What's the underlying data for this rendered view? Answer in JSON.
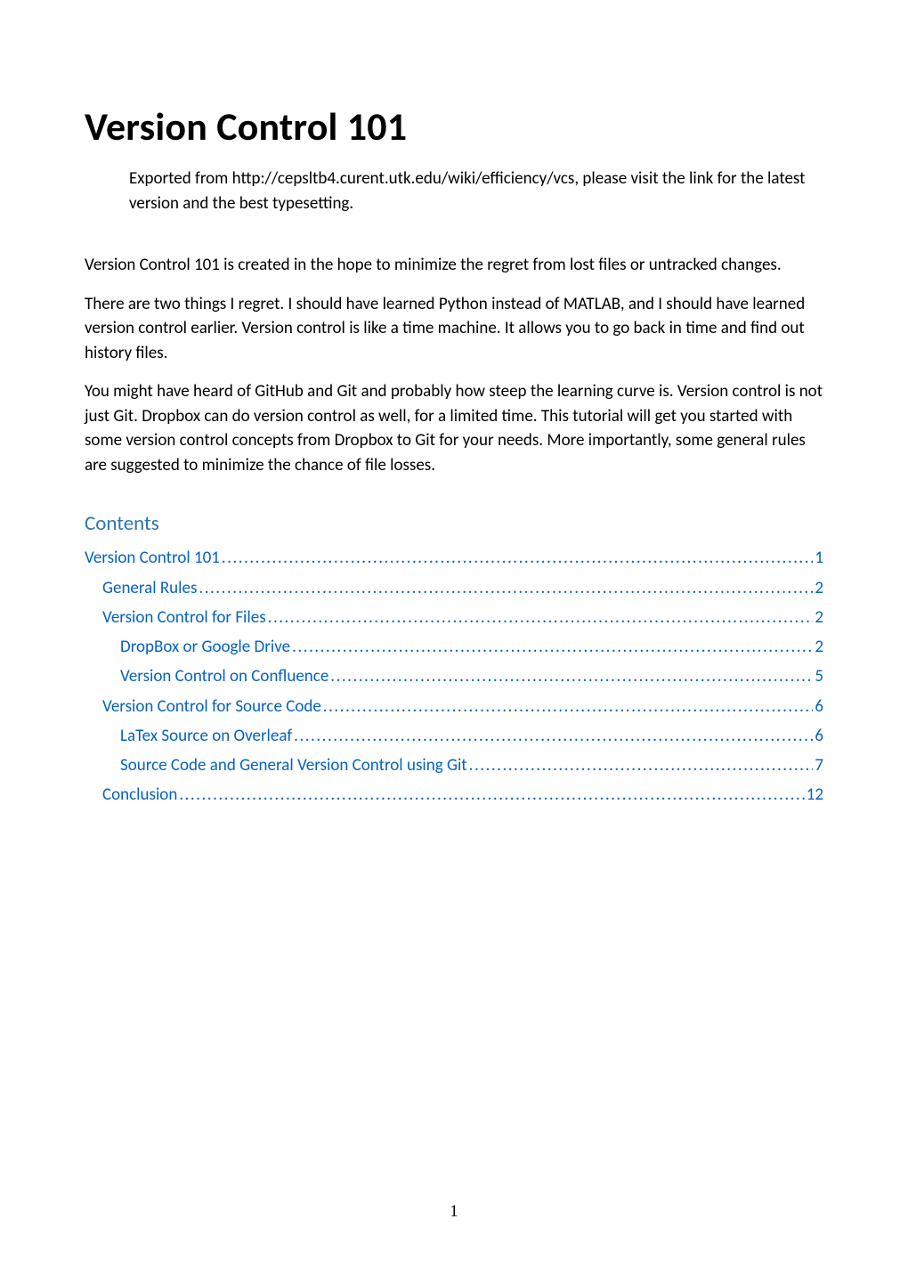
{
  "title": "Version Control 101",
  "export_note": "Exported from http://cepsltb4.curent.utk.edu/wiki/efficiency/vcs, please visit the link for the latest version and the best typesetting.",
  "paragraphs": [
    "Version Control 101 is created in the hope to minimize the regret from lost files or untracked changes.",
    "There are two things I regret. I should have learned Python instead of MATLAB, and I should have learned version control earlier. Version control is like a time machine. It allows you to go back in time and find out history files.",
    "You might have heard of GitHub and Git and probably how steep the learning curve is. Version control is not just Git. Dropbox can do version control as well, for a limited time. This tutorial will get you started with some version control concepts from Dropbox to Git for your needs. More importantly, some general rules are suggested to minimize the chance of file losses."
  ],
  "contents_heading": "Contents",
  "toc": [
    {
      "label": "Version Control 101",
      "page": "1",
      "level": 0
    },
    {
      "label": "General Rules",
      "page": "2",
      "level": 1
    },
    {
      "label": "Version Control for Files",
      "page": "2",
      "level": 1
    },
    {
      "label": "DropBox or Google Drive",
      "page": "2",
      "level": 2
    },
    {
      "label": "Version Control on Confluence",
      "page": "5",
      "level": 2
    },
    {
      "label": "Version Control for Source Code",
      "page": "6",
      "level": 1
    },
    {
      "label": "LaTex Source on Overleaf",
      "page": "6",
      "level": 2
    },
    {
      "label": "Source Code and General Version Control using Git",
      "page": "7",
      "level": 2
    },
    {
      "label": "Conclusion",
      "page": "12",
      "level": 1
    }
  ],
  "page_number": "1"
}
